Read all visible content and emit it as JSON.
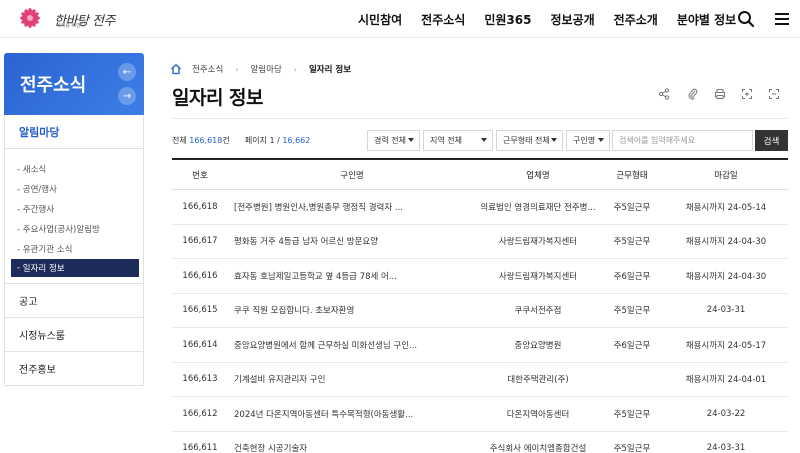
{
  "header": {
    "logo_text": "한바탕 전주",
    "logo_tag": "세계를 비빈다",
    "gnb": [
      "시민참여",
      "전주소식",
      "민원365",
      "정보공개",
      "전주소개",
      "분야별 정보"
    ]
  },
  "sidebar": {
    "title": "전주소식",
    "active_menu": "알림마당",
    "sub_items": [
      "새소식",
      "공연/행사",
      "주간행사",
      "주요사업(공사)알림방",
      "유관기관 소식",
      "일자리 정보"
    ],
    "menus": [
      "공고",
      "시정뉴스룸",
      "전주홍보"
    ]
  },
  "breadcrumb": [
    "전주소식",
    "알림마당",
    "일자리 정보"
  ],
  "page_title": "일자리 정보",
  "info": {
    "total_label": "전체",
    "total_value": "166,618",
    "total_unit": "건",
    "page_label": "페이지",
    "page_current": "1",
    "page_sep": " / ",
    "page_total": "16,662"
  },
  "filters": {
    "career": "경력 전체",
    "region": "지역 전체",
    "worktype": "근무형태 전체",
    "field": "구인명",
    "search_placeholder": "검색어를 입력해주세요",
    "search_button": "검색"
  },
  "table": {
    "headers": [
      "번호",
      "구인명",
      "업체명",
      "근무형태",
      "마감일"
    ],
    "rows": [
      [
        "166,618",
        "[전주병원] 병원인사,병원총무 행정직 경력자 ...",
        "의료법인 영경의료재단 전주병...",
        "주5일근무",
        "채용시까지 24-05-14"
      ],
      [
        "166,617",
        "평화동 거주 4등급 남자 어르신 방문요양",
        "사랑드림재가복지센터",
        "주5일근무",
        "채용시까지 24-04-30"
      ],
      [
        "166,616",
        "효자동 호남제일고등학교 옆 4등급 78세 어...",
        "사랑드림재가복지센터",
        "주6일근무",
        "채용시까지 24-04-30"
      ],
      [
        "166,615",
        "쿠쿠 직원 모집합니다. 초보자환영",
        "쿠쿠서전주점",
        "주5일근무",
        "24-03-31"
      ],
      [
        "166,614",
        "중앙요양병원에서 함께 근무하실 미화선생님 구인...",
        "중앙요양병원",
        "주6일근무",
        "채용시까지 24-05-17"
      ],
      [
        "166,613",
        "기계설비 유지관리자 구인",
        "대한주택관리(주)",
        "",
        "채용시까지 24-04-01"
      ],
      [
        "166,612",
        "2024년 다온지역아동센터 특수목적형(아동생활...",
        "다온지역아동센터",
        "주5일근무",
        "24-03-22"
      ],
      [
        "166,611",
        "건축현장 시공기술자",
        "주식회사 에이치엠종합건설",
        "주5일근무",
        "24-03-31"
      ]
    ]
  }
}
